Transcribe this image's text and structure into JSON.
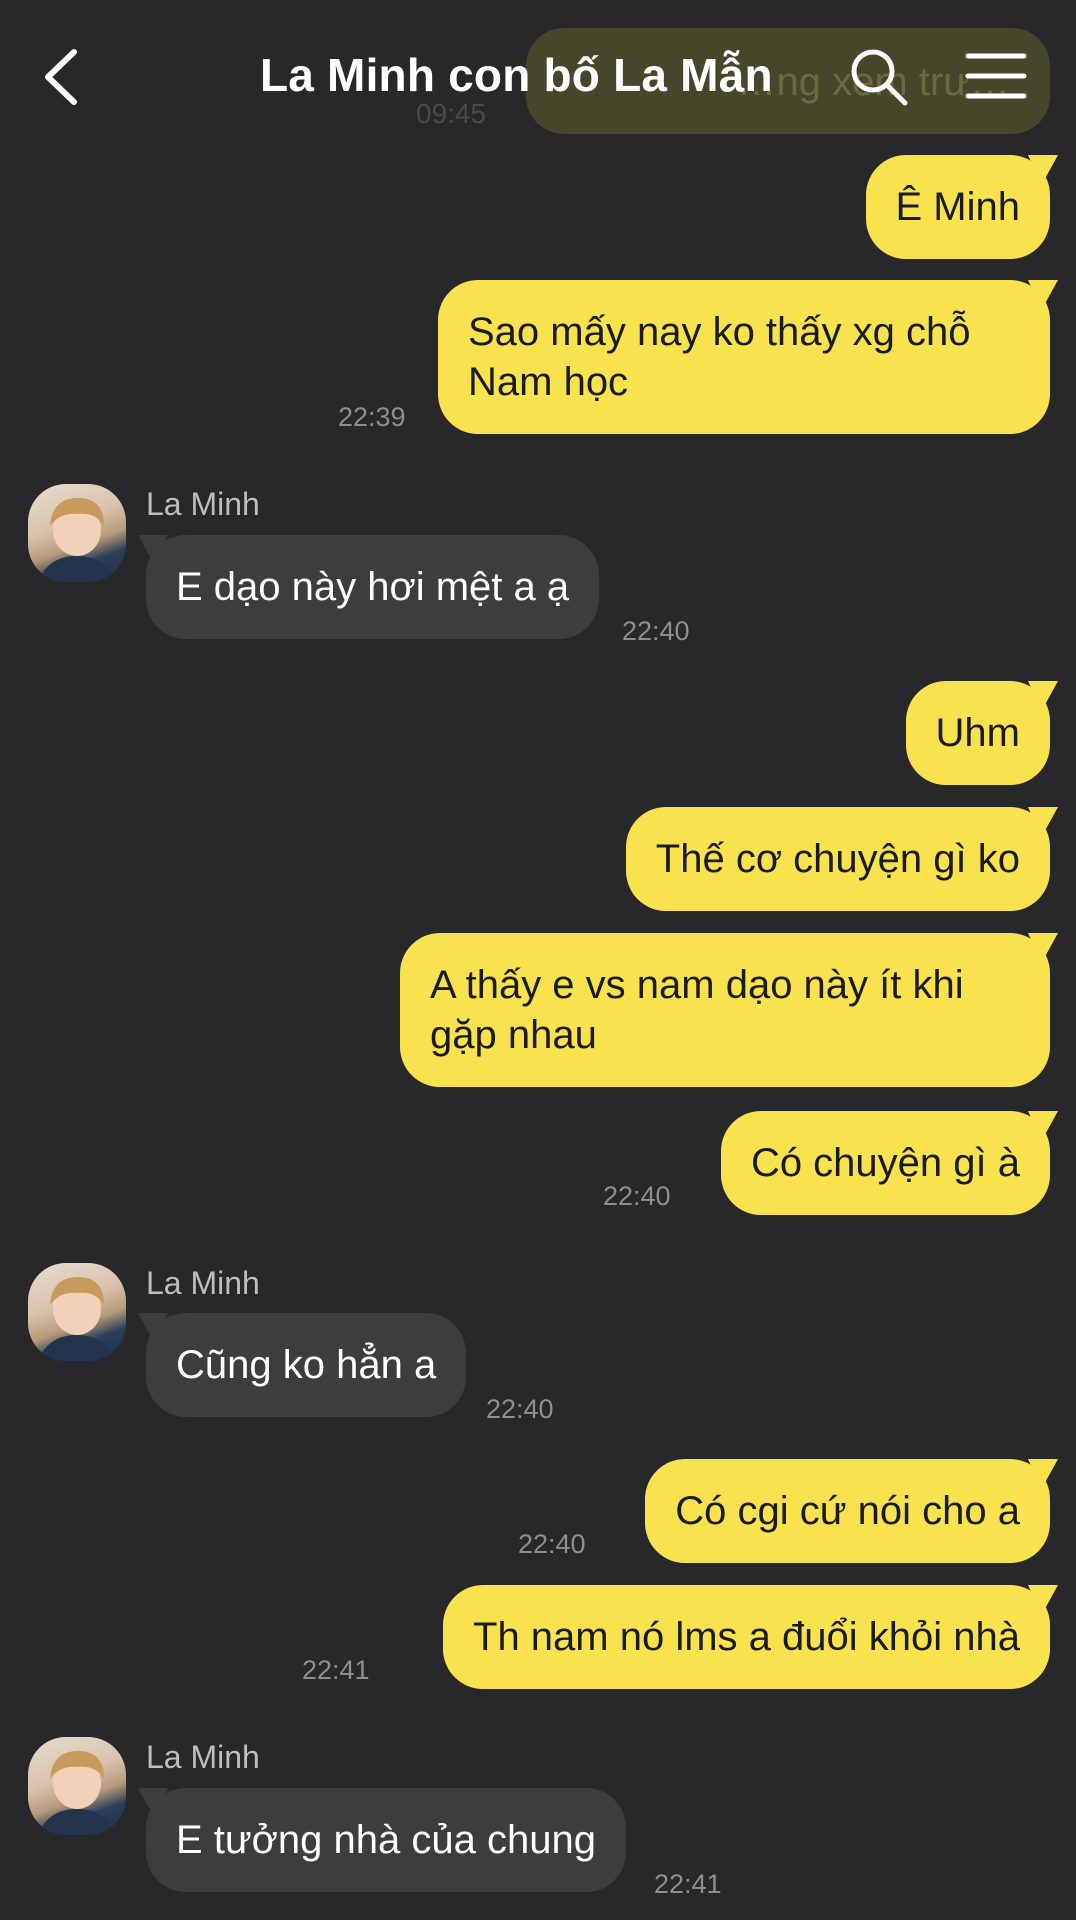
{
  "header": {
    "title": "La Minh con bố La Mẫn",
    "back_icon": "chevron-left-icon",
    "search_icon": "search-icon",
    "menu_icon": "hamburger-menu-icon"
  },
  "partial_message": {
    "text": "…ng xem trư…",
    "time": "09:45"
  },
  "messages": [
    {
      "from": "me",
      "text": "Ê Minh"
    },
    {
      "from": "me",
      "text": "Sao mấy nay ko thấy xg chỗ Nam học",
      "time": "22:39"
    },
    {
      "from": "them",
      "sender": "La Minh",
      "text": "E dạo này hơi mệt a ạ",
      "time": "22:40"
    },
    {
      "from": "me",
      "text": "Uhm"
    },
    {
      "from": "me",
      "text": "Thế cơ chuyện gì ko"
    },
    {
      "from": "me",
      "text": "A thấy e vs nam dạo này ít khi gặp nhau"
    },
    {
      "from": "me",
      "text": "Có chuyện gì à",
      "time": "22:40"
    },
    {
      "from": "them",
      "sender": "La Minh",
      "text": "Cũng ko hẳn a",
      "time": "22:40"
    },
    {
      "from": "me",
      "text": "Có cgi cứ nói cho a",
      "time": "22:40"
    },
    {
      "from": "me",
      "text": "Th nam nó lms a đuổi khỏi nhà",
      "time": "22:41"
    },
    {
      "from": "them",
      "sender": "La Minh",
      "text": "E tưởng nhà của chung",
      "time": "22:41"
    }
  ],
  "colors": {
    "background": "#28282a",
    "my_bubble": "#f8e34f",
    "their_bubble": "#3d3d40"
  }
}
